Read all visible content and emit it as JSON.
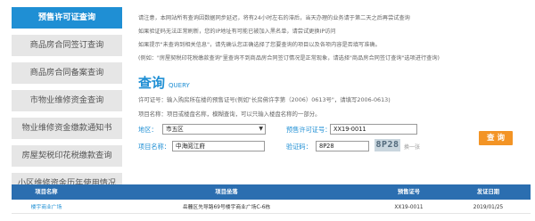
{
  "sidebar": {
    "items": [
      {
        "label": "预售许可证查询",
        "active": true
      },
      {
        "label": "商品房合同签订查询",
        "active": false
      },
      {
        "label": "商品房合同备案查询",
        "active": false
      },
      {
        "label": "市物业维修资金查询",
        "active": false
      },
      {
        "label": "物业维修资金缴款通知书",
        "active": false
      },
      {
        "label": "房屋契税印花税缴款查询",
        "active": false
      },
      {
        "label": "小区维修资金历年使用情况",
        "active": false
      }
    ]
  },
  "notes": {
    "lines": [
      "请注意，本网站所有查询因数据同步延迟，将有24小时左右的滞后，当天办理的业务请于第二天之后再尝试查询",
      "如果验证码无法正常刷新，您的IP地址有可能已被加入黑名单，请尝试更换IP访问",
      "如果提示\"未查询到相关信息\"，请先确认您正确选择了您要查询的项目以及各项内容是否填写准确。",
      "(例如：\"房屋契税印花税缴款查询\"里查询不到商品房合同签订情况是正常现象，请选择\"商品房合同签订查询\"选项进行查询)"
    ]
  },
  "query": {
    "title": "查询",
    "subtitle": "QUERY",
    "hint_permit": "许可证号：输入购房所在楼的预售证号(例如\"长房佛许字第（2006）0613号\"，请填写2006-0613)",
    "hint_project": "项目名称：项目或楼盘名称，模糊查询，可以只输入楼盘名称的一部分。",
    "district_label": "地区：",
    "district_value": "市五区",
    "permit_label": "预售许可证号：",
    "permit_value": "XX19-0011",
    "project_label": "项目名称：",
    "project_value": "中海阅江府",
    "captcha_label": "验证码：",
    "captcha_value": "8P28",
    "captcha_image_text": "8P28",
    "swap_label": "换一张",
    "button_label": "查 询"
  },
  "table": {
    "headers": [
      "项目名称",
      "项目坐落",
      "预售证号",
      "发证日期"
    ],
    "rows": [
      [
        "楼宇商业广场",
        "岳麓区先导路69号楼宇商业广场C-6栋",
        "XX19-0011",
        "2019/01/25"
      ]
    ]
  },
  "colors": {
    "accent": "#1f8fd4",
    "sidebar_bg": "#e6e6e6",
    "header_bg": "#2b6eb0",
    "button_bg": "#f39425"
  }
}
